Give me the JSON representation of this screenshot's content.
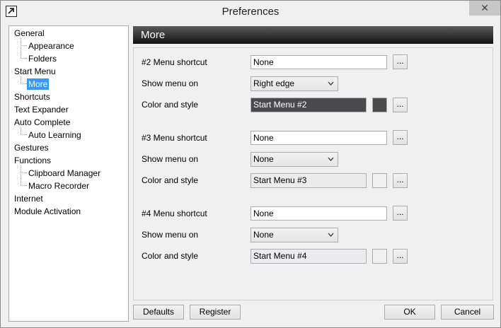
{
  "window": {
    "title": "Preferences",
    "close_glyph": "✕"
  },
  "sidebar": {
    "items": [
      {
        "label": "General"
      },
      {
        "label": "Appearance"
      },
      {
        "label": "Folders"
      },
      {
        "label": "Start Menu"
      },
      {
        "label": "More"
      },
      {
        "label": "Shortcuts"
      },
      {
        "label": "Text Expander"
      },
      {
        "label": "Auto Complete"
      },
      {
        "label": "Auto Learning"
      },
      {
        "label": "Gestures"
      },
      {
        "label": "Functions"
      },
      {
        "label": "Clipboard Manager"
      },
      {
        "label": "Macro Recorder"
      },
      {
        "label": "Internet"
      },
      {
        "label": "Module Activation"
      }
    ],
    "selected": "More"
  },
  "main": {
    "header": "More",
    "ellipsis": "...",
    "groups": [
      {
        "shortcut_label": "#2 Menu shortcut",
        "shortcut_value": "None",
        "show_label": "Show menu on",
        "show_value": "Right edge",
        "style_label": "Color and style",
        "style_value": "Start Menu #2",
        "style_bg": "#4a4a4a",
        "style_fg": "#ffffff",
        "swatch_color": "#4a4a4a"
      },
      {
        "shortcut_label": "#3 Menu shortcut",
        "shortcut_value": "None",
        "show_label": "Show menu on",
        "show_value": "None",
        "style_label": "Color and style",
        "style_value": "Start Menu #3",
        "style_bg": "#ececec",
        "style_fg": "#000000",
        "swatch_color": "#f0f0f0"
      },
      {
        "shortcut_label": "#4 Menu shortcut",
        "shortcut_value": "None",
        "show_label": "Show menu on",
        "show_value": "None",
        "style_label": "Color and style",
        "style_value": "Start Menu #4",
        "style_bg": "#ececec",
        "style_fg": "#000000",
        "swatch_color": "#f0f0f0"
      }
    ]
  },
  "footer": {
    "defaults_label": "Defaults",
    "register_label": "Register",
    "ok_label": "OK",
    "cancel_label": "Cancel"
  }
}
